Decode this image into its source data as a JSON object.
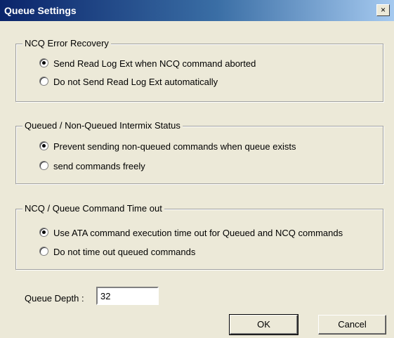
{
  "window": {
    "title": "Queue Settings",
    "close_glyph": "×"
  },
  "groups": [
    {
      "legend": "NCQ Error Recovery",
      "options": [
        {
          "label": "Send Read Log Ext when NCQ command aborted",
          "checked": true
        },
        {
          "label": "Do not Send Read Log Ext automatically",
          "checked": false
        }
      ]
    },
    {
      "legend": "Queued / Non-Queued Intermix Status",
      "options": [
        {
          "label": "Prevent sending non-queued commands when queue exists",
          "checked": true
        },
        {
          "label": "send commands freely",
          "checked": false
        }
      ]
    },
    {
      "legend": "NCQ / Queue Command Time out",
      "options": [
        {
          "label": "Use ATA command execution time out for Queued and NCQ commands",
          "checked": true
        },
        {
          "label": "Do not time out queued commands",
          "checked": false
        }
      ]
    }
  ],
  "queue_depth": {
    "label": "Queue Depth :",
    "value": "32"
  },
  "buttons": {
    "ok": "OK",
    "cancel": "Cancel"
  }
}
